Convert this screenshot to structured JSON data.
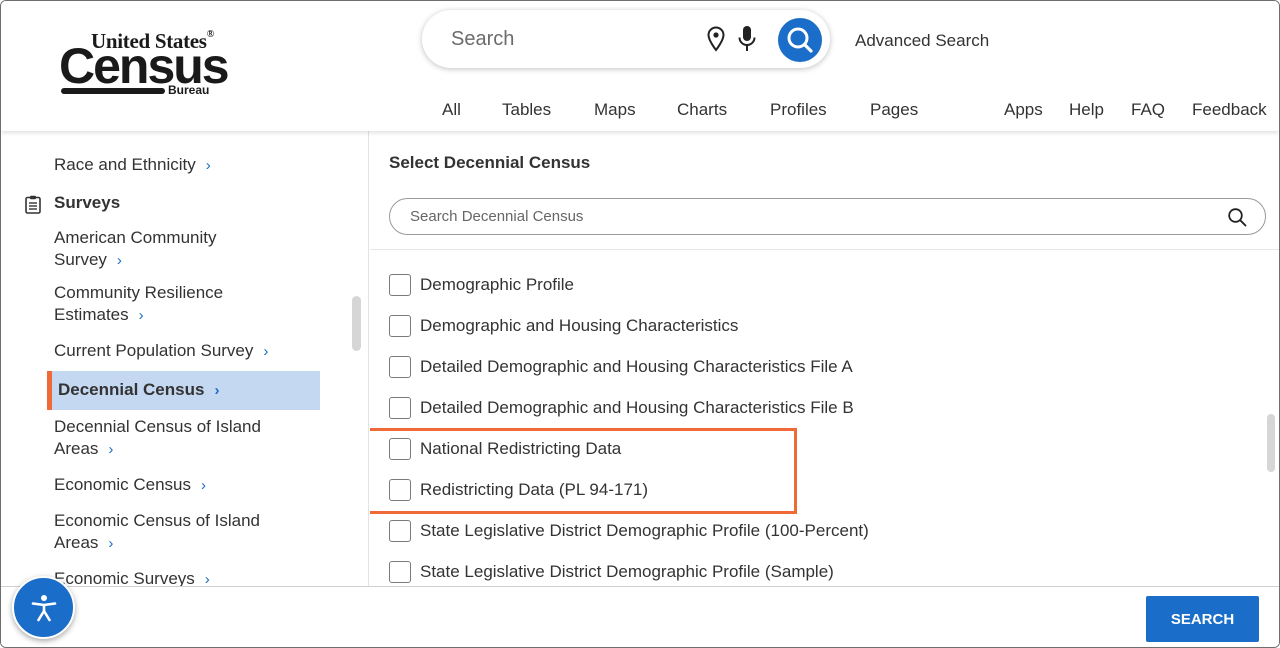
{
  "header": {
    "logo": {
      "line1": "United States",
      "reg": "®",
      "line2": "Census",
      "line3": "Bureau"
    },
    "search": {
      "placeholder": "Search"
    },
    "advanced_search": "Advanced Search",
    "tabs": [
      "All",
      "Tables",
      "Maps",
      "Charts",
      "Profiles",
      "Pages"
    ],
    "utility_links": [
      "Apps",
      "Help",
      "FAQ",
      "Feedback"
    ]
  },
  "sidebar": {
    "items_top": [
      {
        "label": "Race and Ethnicity"
      }
    ],
    "section_heading": "Surveys",
    "items": [
      {
        "label_line1": "American Community",
        "label_line2": "Survey"
      },
      {
        "label_line1": "Community Resilience",
        "label_line2": "Estimates"
      },
      {
        "label_line1": "Current Population Survey",
        "label_line2": ""
      },
      {
        "label_line1": "Decennial Census",
        "label_line2": "",
        "active": true
      },
      {
        "label_line1": "Decennial Census of Island",
        "label_line2": "Areas"
      },
      {
        "label_line1": "Economic Census",
        "label_line2": ""
      },
      {
        "label_line1": "Economic Census of Island",
        "label_line2": "Areas"
      },
      {
        "label_line1": "Economic Surveys",
        "label_line2": ""
      }
    ],
    "chevron": "›"
  },
  "main": {
    "title": "Select Decennial Census",
    "search_placeholder": "Search Decennial Census",
    "options": [
      "Demographic Profile",
      "Demographic and Housing Characteristics",
      "Detailed Demographic and Housing Characteristics File A",
      "Detailed Demographic and Housing Characteristics File B",
      "National Redistricting Data",
      "Redistricting Data (PL 94-171)",
      "State Legislative District Demographic Profile (100-Percent)",
      "State Legislative District Demographic Profile (Sample)"
    ]
  },
  "footer": {
    "search_button": "SEARCH"
  },
  "colors": {
    "accent_blue": "#1a6dc9",
    "highlight_orange": "#f06a37",
    "active_bg": "#c5d8f2"
  }
}
